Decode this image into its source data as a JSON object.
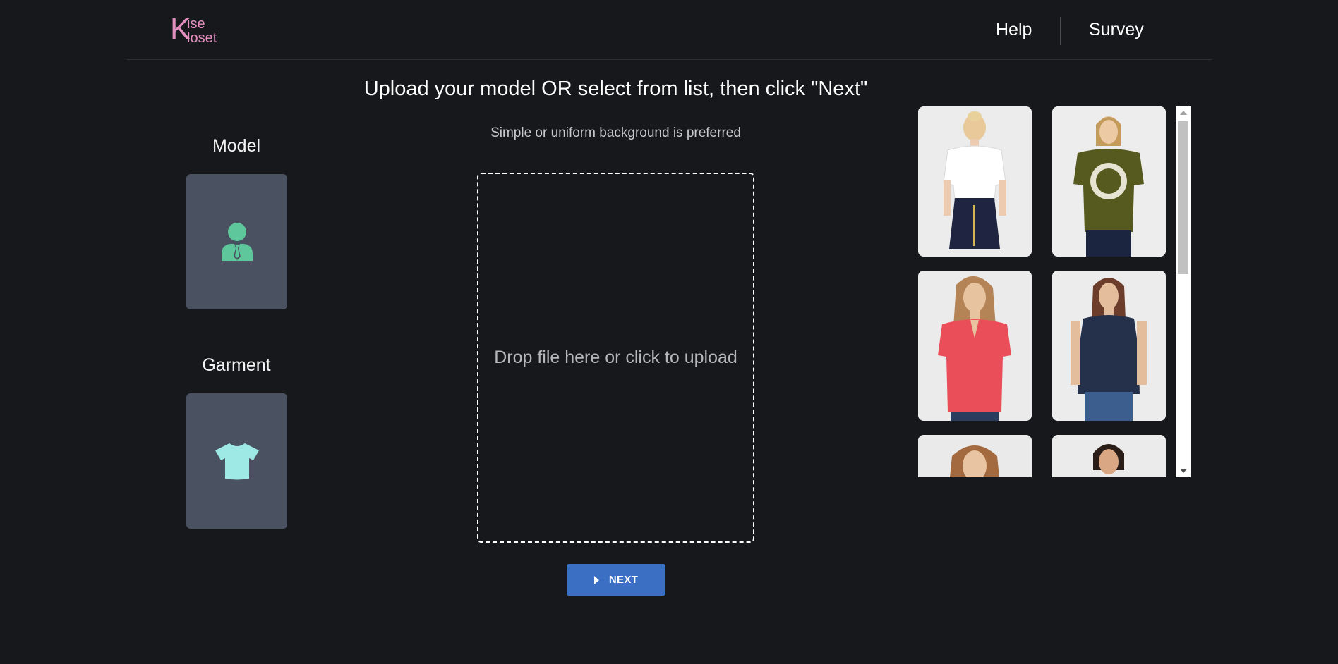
{
  "header": {
    "logo": {
      "letter": "K",
      "line1": "ise",
      "line2": "loset"
    },
    "nav": {
      "help": "Help",
      "survey": "Survey"
    }
  },
  "sidebar": {
    "model_label": "Model",
    "garment_label": "Garment",
    "model_icon": "person-tie-icon",
    "garment_icon": "tshirt-icon"
  },
  "main": {
    "title": "Upload your model OR select from list, then click \"Next\"",
    "subtitle": "Simple or uniform background is preferred",
    "dropzone_text": "Drop file here or click to upload",
    "next_button": "NEXT"
  },
  "gallery": {
    "items": [
      {
        "name": "model-white-top-denim-skirt"
      },
      {
        "name": "model-olive-graphic-tee"
      },
      {
        "name": "model-coral-blouse"
      },
      {
        "name": "model-navy-sleeveless-top"
      },
      {
        "name": "model-partial-1"
      },
      {
        "name": "model-partial-2"
      }
    ]
  },
  "colors": {
    "background": "#17181c",
    "card": "#4a5261",
    "accent_button": "#3b6fc4",
    "logo": "#e58fc0",
    "model_icon": "#5ec79c",
    "garment_icon": "#9ee9e5"
  }
}
